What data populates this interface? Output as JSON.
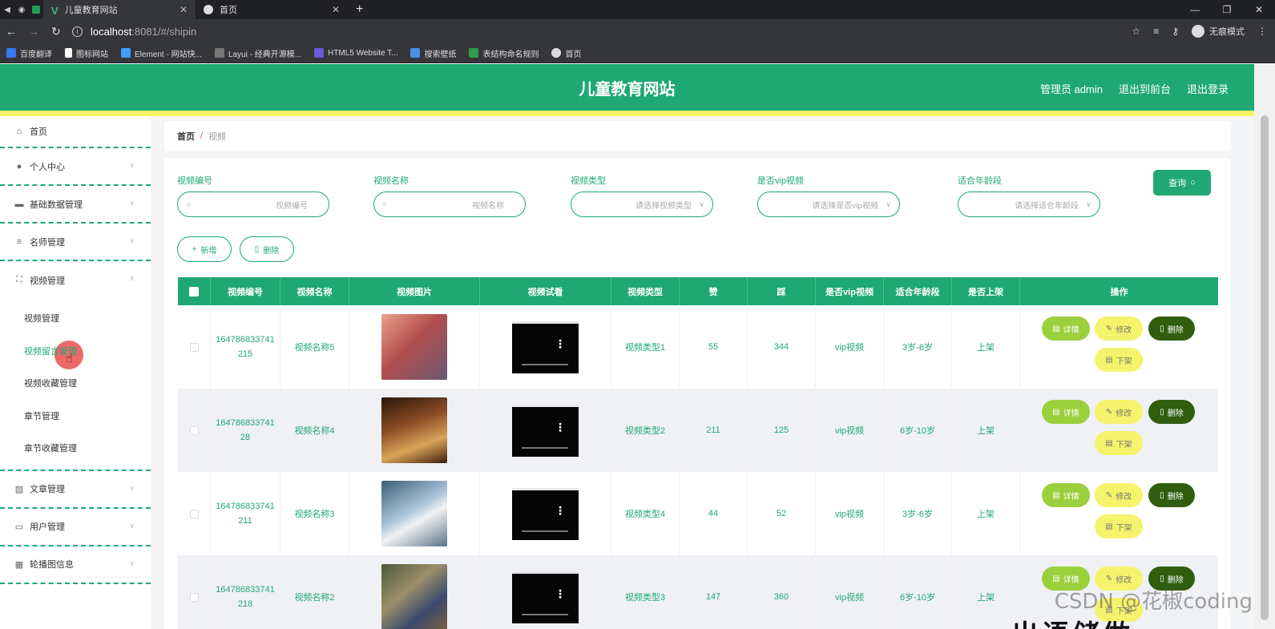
{
  "browser": {
    "tabs": [
      {
        "title": "儿童教育网站",
        "favicon_color": "#41b883",
        "active": true
      },
      {
        "title": "首页",
        "favicon_color": "#dddddd",
        "active": false
      }
    ],
    "url_host": "localhost",
    "url_path": ":8081/#/shipin",
    "incognito_label": "无痕模式",
    "bookmarks": [
      {
        "label": "百度翻译",
        "color": "#3478f6"
      },
      {
        "label": "图标网站",
        "color": "#ffffff"
      },
      {
        "label": "Element - 网站快...",
        "color": "#409eff"
      },
      {
        "label": "Layui - 经典开源模...",
        "color": "#cccccc"
      },
      {
        "label": "HTML5 Website T...",
        "color": "#6b5bd6"
      },
      {
        "label": "搜索壁纸",
        "color": "#4a90e2"
      },
      {
        "label": "表结构命名规则",
        "color": "#2e9b4e"
      },
      {
        "label": "首页",
        "color": "#dddddd"
      }
    ]
  },
  "header": {
    "title": "儿童教育网站",
    "admin_label": "管理员 admin",
    "back_label": "退出到前台",
    "logout_label": "退出登录"
  },
  "sidebar": {
    "home": "首页",
    "menus_top": [
      {
        "label": "个人中心",
        "icon": "user-icon"
      },
      {
        "label": "基础数据管理",
        "icon": "chat-icon"
      },
      {
        "label": "名师管理",
        "icon": "list-icon"
      },
      {
        "label": "视频管理",
        "icon": "expand-icon"
      }
    ],
    "submenu": [
      "视频管理",
      "视频留言管理",
      "视频收藏管理",
      "章节管理",
      "章节收藏管理"
    ],
    "menus_bottom": [
      {
        "label": "文章管理",
        "icon": "chart-icon"
      },
      {
        "label": "用户管理",
        "icon": "card-icon"
      },
      {
        "label": "轮播图信息",
        "icon": "grid-icon"
      }
    ]
  },
  "breadcrumb": {
    "home": "首页",
    "sep": "/",
    "current": "视频"
  },
  "search": {
    "fields": [
      {
        "label": "视频编号",
        "placeholder": "视频编号"
      },
      {
        "label": "视频名称",
        "placeholder": "视频名称"
      },
      {
        "label": "视频类型",
        "placeholder": "请选择视频类型"
      },
      {
        "label": "是否vip视频",
        "placeholder": "请选择是否vip视频"
      },
      {
        "label": "适合年龄段",
        "placeholder": "请选择适合年龄段"
      }
    ],
    "query_label": "查询"
  },
  "actions": {
    "add_label": "新增",
    "delete_label": "删除"
  },
  "table": {
    "headers": [
      "视频编号",
      "视频名称",
      "视频图片",
      "视频试看",
      "视频类型",
      "赞",
      "踩",
      "是否vip视频",
      "适合年龄段",
      "是否上架",
      "操作"
    ],
    "rows": [
      {
        "id": "164786833741215",
        "name": "视频名称5",
        "type": "视频类型1",
        "likes": "55",
        "dislikes": "344",
        "vip": "vip视频",
        "age": "3岁-6岁",
        "status": "上架",
        "thumb": "#c9706b"
      },
      {
        "id": "16478683374128",
        "name": "视频名称4",
        "type": "视频类型2",
        "likes": "211",
        "dislikes": "125",
        "vip": "vip视频",
        "age": "6岁-10岁",
        "status": "上架",
        "thumb": "#6a3a22"
      },
      {
        "id": "164786833741211",
        "name": "视频名称3",
        "type": "视频类型4",
        "likes": "44",
        "dislikes": "52",
        "vip": "vip视频",
        "age": "3岁-6岁",
        "status": "上架",
        "thumb": "#7a9eb6"
      },
      {
        "id": "164786833741218",
        "name": "视频名称2",
        "type": "视频类型3",
        "likes": "147",
        "dislikes": "360",
        "vip": "vip视频",
        "age": "6岁-10岁",
        "status": "上架",
        "thumb": "#6f6a4e"
      }
    ],
    "ops": {
      "detail": "详情",
      "edit": "修改",
      "delete": "删除",
      "offshelf": "下架"
    }
  },
  "watermark": "CSDN @花椒coding",
  "overlay_text": "出语储做"
}
